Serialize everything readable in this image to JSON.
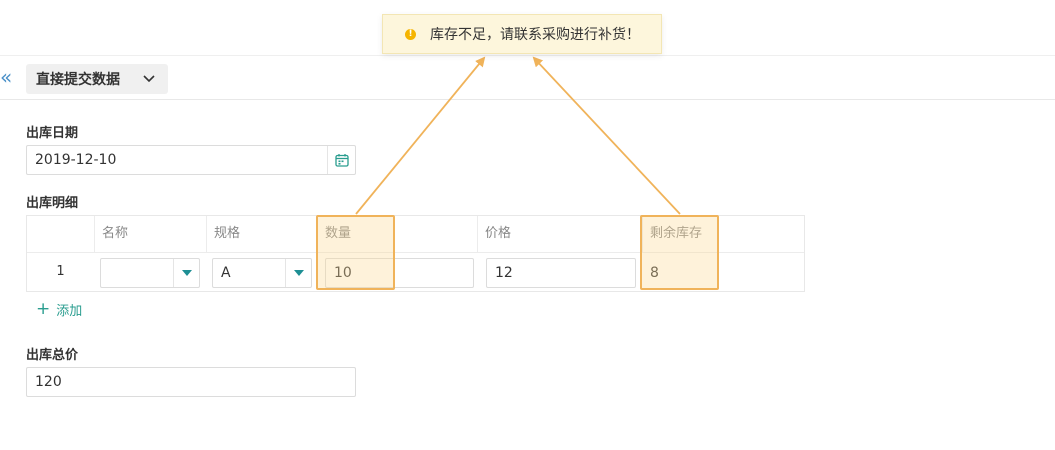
{
  "toast": {
    "message": "库存不足，请联系采购进行补货！",
    "icon": "warning-icon",
    "color": "#f5b400"
  },
  "topbar": {
    "tab_label": "直接提交数据",
    "collapse_icon": "double-chevron-left-icon"
  },
  "form": {
    "date_label": "出库日期",
    "date_value": "2019-12-10",
    "detail_label": "出库明细",
    "total_label": "出库总价",
    "total_value": "120"
  },
  "table": {
    "columns": [
      "名称",
      "规格",
      "数量",
      "价格",
      "剩余库存"
    ],
    "rows": [
      {
        "index": "1",
        "name": "",
        "spec": "A",
        "quantity": "10",
        "price": "12",
        "remaining": "8"
      }
    ],
    "add_label": "添加"
  },
  "colors": {
    "accent": "#2a9d8f",
    "highlight": "#f0b35a",
    "link_blue": "#4a90c8"
  }
}
